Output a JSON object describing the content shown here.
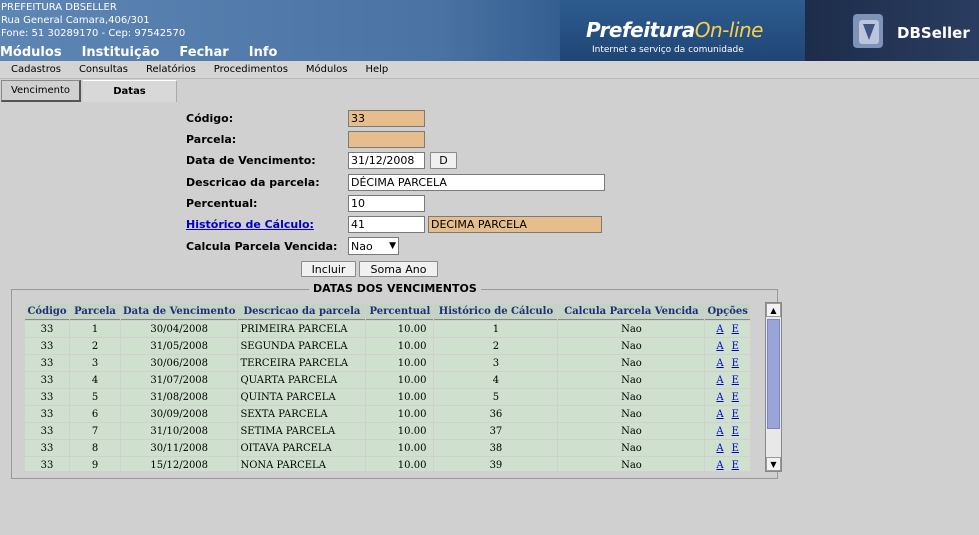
{
  "header": {
    "org_name": "PREFEITURA DBSELLER",
    "address": "Rua General Camara,406/301",
    "phone": "Fone: 51 30289170  -  Cep: 97542570",
    "menu": [
      "Módulos",
      "Instituição",
      "Fechar",
      "Info"
    ],
    "logo_title_main": "Prefeitura",
    "logo_title_accent": "On-line",
    "logo_subtitle": "Internet a serviço da comunidade",
    "brand": "DBSeller"
  },
  "sub_menu": [
    "Cadastros",
    "Consultas",
    "Relatórios",
    "Procedimentos",
    "Módulos",
    "Help"
  ],
  "tabs": [
    "Vencimento",
    "Datas"
  ],
  "form": {
    "codigo_label": "Código:",
    "codigo_value": "33",
    "parcela_label": "Parcela:",
    "parcela_value": "",
    "data_label": "Data de Vencimento:",
    "data_value": "31/12/2008",
    "data_button": "D",
    "descricao_label": "Descricao da parcela:",
    "descricao_value": "DÉCIMA PARCELA",
    "percentual_label": "Percentual:",
    "percentual_value": "10",
    "historico_label": "Histórico de Cálculo:",
    "historico_code": "41",
    "historico_desc": "DECIMA PARCELA",
    "calcula_label": "Calcula Parcela Vencida:",
    "calcula_value": "Nao",
    "incluir_button": "Incluir",
    "soma_ano_button": "Soma Ano"
  },
  "table": {
    "legend": "DATAS DOS VENCIMENTOS",
    "headers": [
      "Código",
      "Parcela",
      "Data de Vencimento",
      "Descricao da parcela",
      "Percentual",
      "Histórico de Cálculo",
      "Calcula Parcela Vencida",
      "Opções"
    ],
    "option_a": "A",
    "option_e": "E",
    "rows": [
      [
        "33",
        "1",
        "30/04/2008",
        "PRIMEIRA PARCELA",
        "10.00",
        "1",
        "Nao"
      ],
      [
        "33",
        "2",
        "31/05/2008",
        "SEGUNDA PARCELA",
        "10.00",
        "2",
        "Nao"
      ],
      [
        "33",
        "3",
        "30/06/2008",
        "TERCEIRA PARCELA",
        "10.00",
        "3",
        "Nao"
      ],
      [
        "33",
        "4",
        "31/07/2008",
        "QUARTA PARCELA",
        "10.00",
        "4",
        "Nao"
      ],
      [
        "33",
        "5",
        "31/08/2008",
        "QUINTA PARCELA",
        "10.00",
        "5",
        "Nao"
      ],
      [
        "33",
        "6",
        "30/09/2008",
        "SEXTA PARCELA",
        "10.00",
        "36",
        "Nao"
      ],
      [
        "33",
        "7",
        "31/10/2008",
        "SETIMA PARCELA",
        "10.00",
        "37",
        "Nao"
      ],
      [
        "33",
        "8",
        "30/11/2008",
        "OITAVA PARCELA",
        "10.00",
        "38",
        "Nao"
      ],
      [
        "33",
        "9",
        "15/12/2008",
        "NONA PARCELA",
        "10.00",
        "39",
        "Nao"
      ]
    ]
  }
}
